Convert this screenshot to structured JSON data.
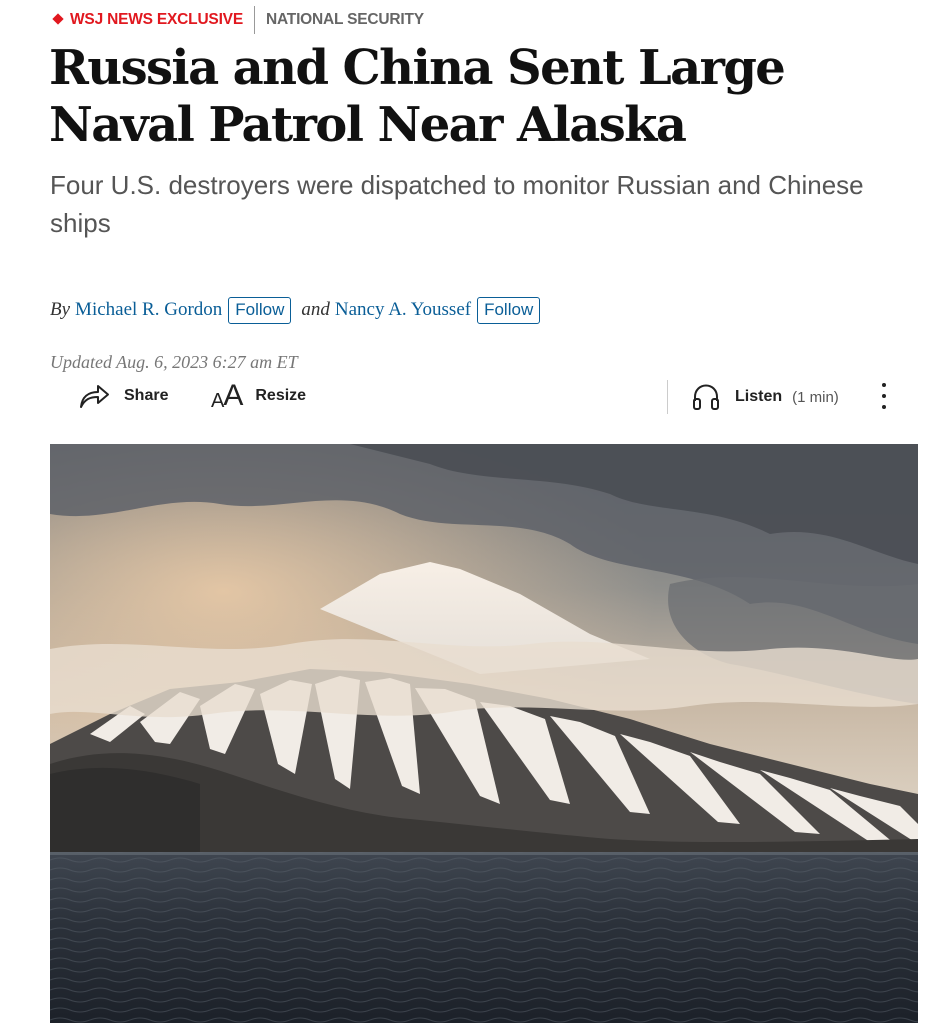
{
  "kicker": {
    "exclusive_label": "WSJ NEWS EXCLUSIVE",
    "section_label": "NATIONAL SECURITY"
  },
  "article": {
    "headline": "Russia and China Sent Large Naval Patrol Near Alaska",
    "dek": "Four U.S. destroyers were dispatched to monitor Russian and Chinese ships"
  },
  "byline": {
    "by_label": "By",
    "and_label": "and",
    "authors": [
      {
        "name": "Michael R. Gordon",
        "follow_label": "Follow"
      },
      {
        "name": "Nancy A. Youssef",
        "follow_label": "Follow"
      }
    ]
  },
  "timestamp": "Updated Aug. 6, 2023 6:27 am ET",
  "toolbar": {
    "share_label": "Share",
    "resize_label": "Resize",
    "listen_label": "Listen",
    "listen_duration": "(1 min)",
    "more_icon": "vertical-ellipsis-icon"
  },
  "hero_image": {
    "subject": "snow-streaked volcano rising above dark sea under clouds"
  },
  "colors": {
    "accent_red": "#e1181f",
    "link_blue": "#0a5e97",
    "headline": "#111111",
    "dek": "#555555",
    "meta": "#777777"
  }
}
